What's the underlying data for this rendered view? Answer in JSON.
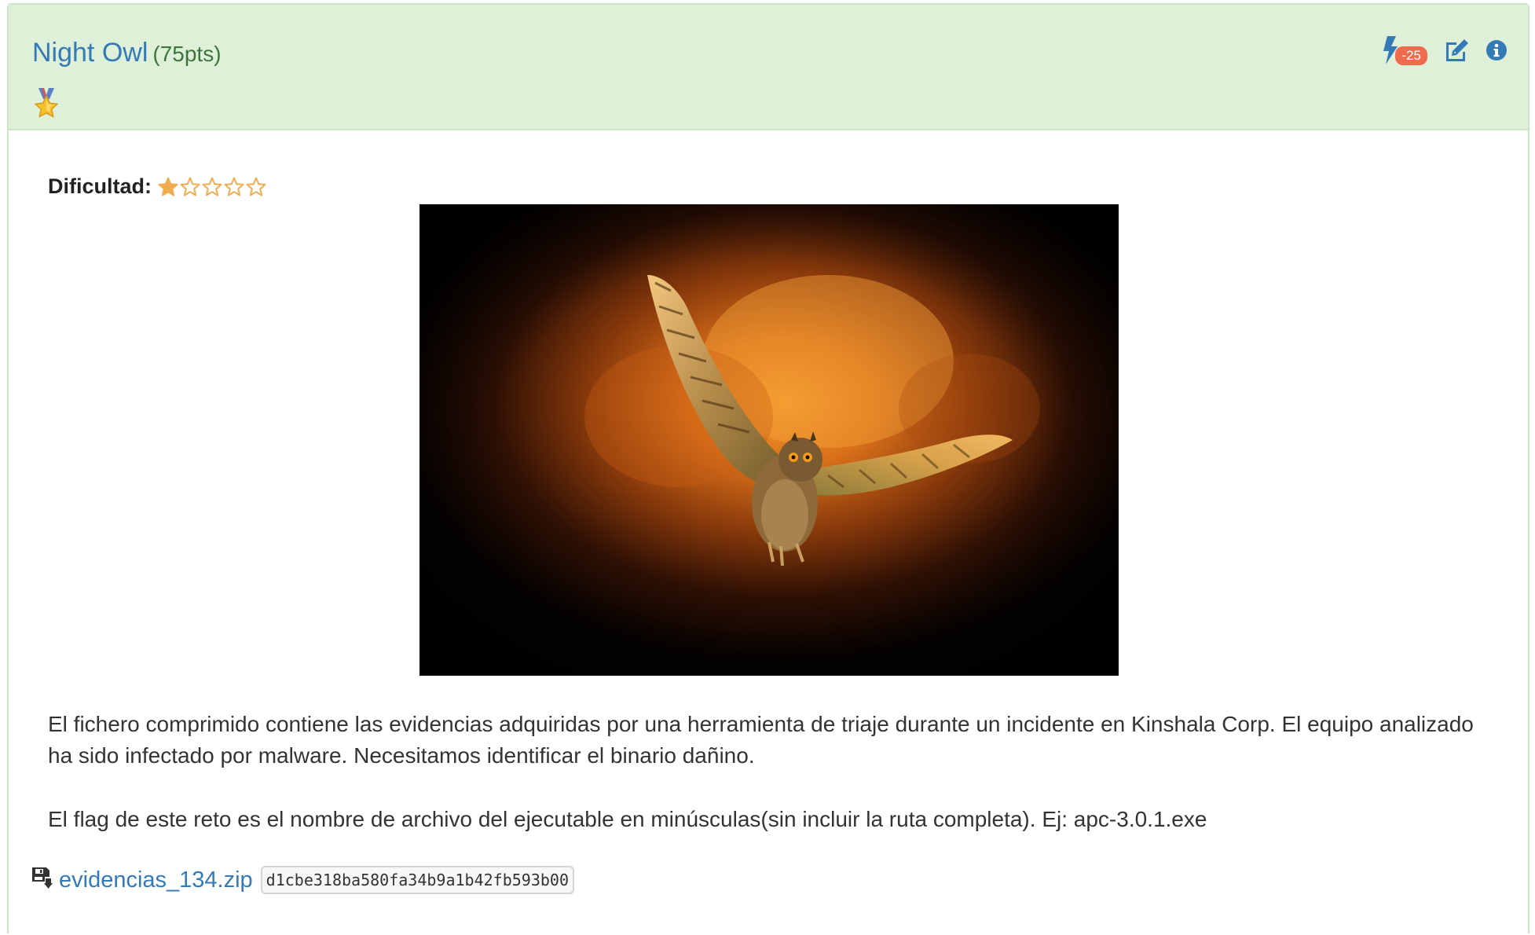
{
  "challenge": {
    "title": "Night Owl",
    "points": "(75pts)",
    "medal_icon": "medal-star-icon"
  },
  "header_actions": {
    "bolt_icon": "lightning-bolt-icon",
    "bolt_badge": "-25",
    "edit_icon": "edit-icon",
    "info_icon": "info-circle-icon"
  },
  "difficulty": {
    "label": "Dificultad:",
    "rating": 1,
    "max": 5
  },
  "image": {
    "description_icon": "owl-image"
  },
  "description": {
    "paragraph_1": "El fichero comprimido contiene las evidencias adquiridas por una herramienta de triaje durante un incidente en Kinshala Corp. El equipo analizado ha sido infectado por malware. Necesitamos identificar el binario dañino.",
    "paragraph_2": "El flag de este reto es el nombre de archivo del ejecutable en minúsculas(sin incluir la ruta completa). Ej: apc-3.0.1.exe"
  },
  "attachment": {
    "icon": "download-file-icon",
    "filename": "evidencias_134.zip",
    "hash": "d1cbe318ba580fa34b9a1b42fb593b00"
  },
  "colors": {
    "header_bg": "#dff0d8",
    "title_link": "#337ab7",
    "points": "#3c763d",
    "badge": "#f06a4d",
    "star": "#f0ad4e"
  }
}
